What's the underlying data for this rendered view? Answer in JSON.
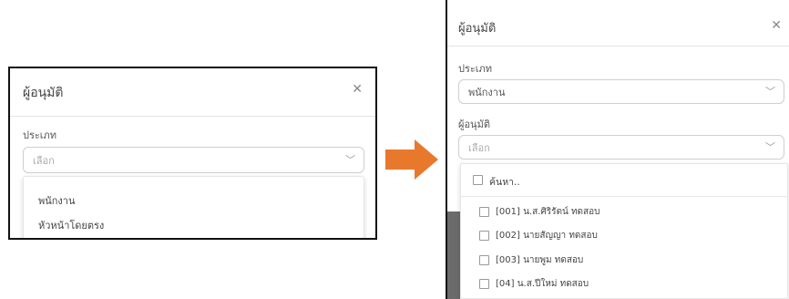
{
  "left": {
    "title": "ผู้อนุมัติ",
    "close_icon": "close-icon",
    "type_label": "ประเภท",
    "type_select": {
      "placeholder": "เลือก"
    },
    "dropdown_options": [
      "พนักงาน",
      "หัวหน้าโดยตรง"
    ]
  },
  "right": {
    "title": "ผู้อนุมัติ",
    "close_icon": "close-icon",
    "type_label": "ประเภท",
    "type_select": {
      "value": "พนักงาน"
    },
    "approver_label": "ผู้อนุมัติ",
    "approver_select": {
      "placeholder": "เลือก"
    },
    "search_label": "ค้นหา..",
    "options": [
      "[001] น.ส.ศิริรัตน์ ทดสอบ",
      "[002] นายสัญญา ทดสอบ",
      "[003] นายพูม ทดสอบ",
      "[04] น.ส.ปีใหม่ ทดสอบ"
    ]
  },
  "colors": {
    "arrow": "#e8792c",
    "border": "#111111"
  }
}
